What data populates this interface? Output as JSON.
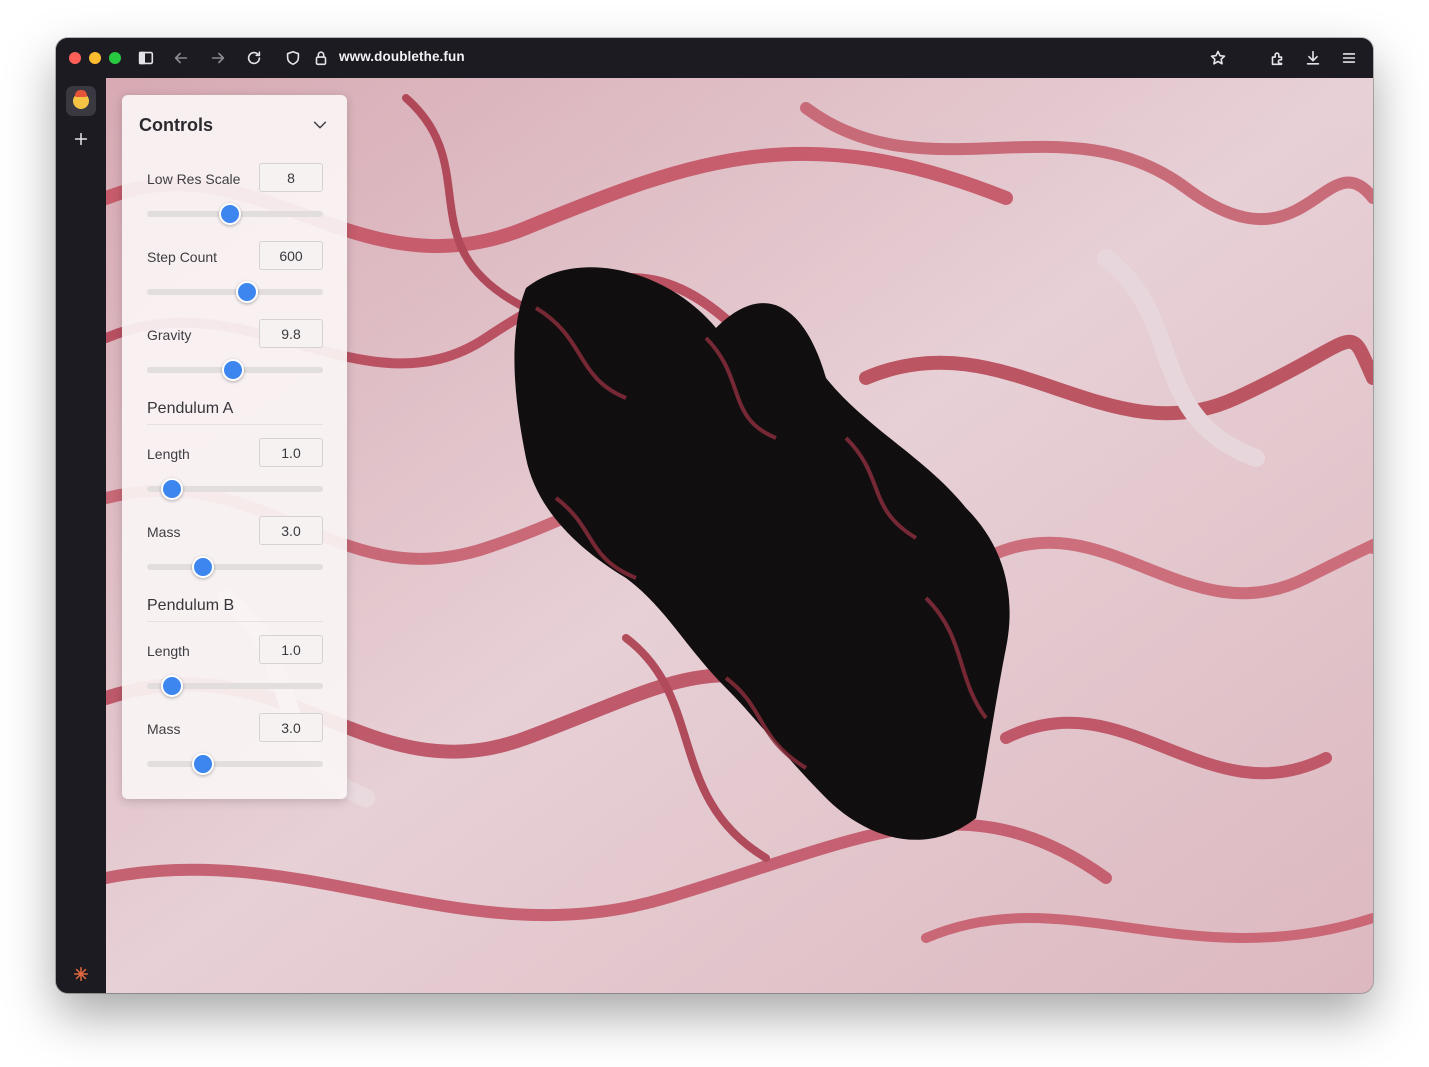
{
  "browser": {
    "url": "www.doublethe.fun"
  },
  "sidebar": {
    "items": [
      "avatar",
      "new-tab",
      "extension",
      "settings"
    ]
  },
  "controls": {
    "title": "Controls",
    "rows": [
      {
        "label": "Low Res Scale",
        "value": "8",
        "fraction": 0.47
      },
      {
        "label": "Step Count",
        "value": "600",
        "fraction": 0.57
      },
      {
        "label": "Gravity",
        "value": "9.8",
        "fraction": 0.49
      }
    ],
    "pendulum_a": {
      "title": "Pendulum A",
      "length": {
        "label": "Length",
        "value": "1.0",
        "fraction": 0.14
      },
      "mass": {
        "label": "Mass",
        "value": "3.0",
        "fraction": 0.32
      }
    },
    "pendulum_b": {
      "title": "Pendulum B",
      "length": {
        "label": "Length",
        "value": "1.0",
        "fraction": 0.14
      },
      "mass": {
        "label": "Mass",
        "value": "3.0",
        "fraction": 0.32
      }
    }
  },
  "colors": {
    "accent": "#3d86f0",
    "chrome": "#1c1b22",
    "fractal_pink": "#c8515f",
    "fractal_light": "#efe2e6"
  }
}
